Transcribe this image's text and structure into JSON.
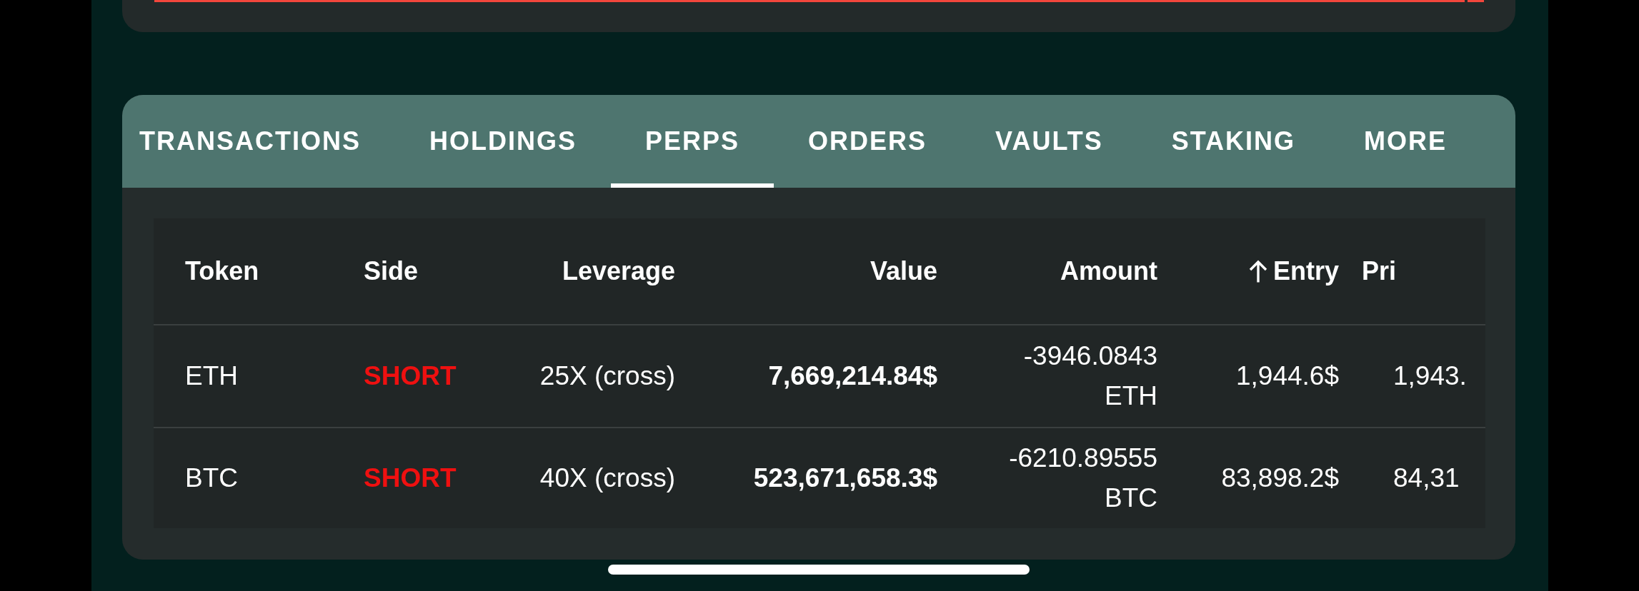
{
  "tabs": [
    {
      "label": "TRANSACTIONS",
      "selected": false
    },
    {
      "label": "HOLDINGS",
      "selected": false
    },
    {
      "label": "PERPS",
      "selected": true
    },
    {
      "label": "ORDERS",
      "selected": false
    },
    {
      "label": "VAULTS",
      "selected": false
    },
    {
      "label": "STAKING",
      "selected": false
    },
    {
      "label": "MORE",
      "selected": false
    }
  ],
  "table": {
    "columns": [
      {
        "label": "Token",
        "sorted": false
      },
      {
        "label": "Side",
        "sorted": false
      },
      {
        "label": "Leverage",
        "sorted": false
      },
      {
        "label": "Value",
        "sorted": false
      },
      {
        "label": "Amount",
        "sorted": false
      },
      {
        "label": "Entry",
        "sorted": true
      },
      {
        "label": "Pri",
        "sorted": false
      }
    ],
    "rows": [
      {
        "token": "ETH",
        "side": {
          "label": "SHORT",
          "color": "#ef1010"
        },
        "leverage": "25X (cross)",
        "value": "7,669,214.84$",
        "amount": "-3946.0843 ETH",
        "entry": "1,944.6$",
        "column_7": "1,943."
      },
      {
        "token": "BTC",
        "side": {
          "label": "SHORT",
          "color": "#ef1010"
        },
        "leverage": "40X (cross)",
        "value": "523,671,658.3$",
        "amount": "-6210.89555 BTC",
        "entry": "83,898.2$",
        "column_7": "84,31"
      }
    ]
  }
}
